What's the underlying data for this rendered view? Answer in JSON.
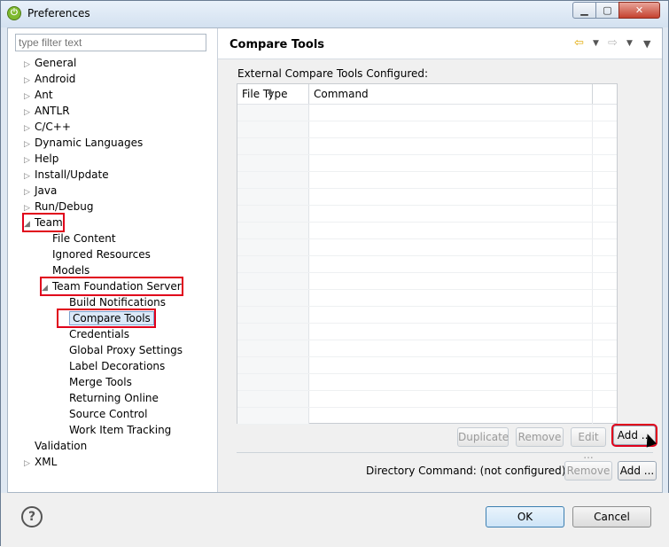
{
  "window": {
    "title": "Preferences",
    "app_icon": "eclipse-icon"
  },
  "filter": {
    "placeholder": "type filter text"
  },
  "tree": [
    {
      "label": "General",
      "arrow": "▷",
      "level": 0
    },
    {
      "label": "Android",
      "arrow": "▷",
      "level": 0
    },
    {
      "label": "Ant",
      "arrow": "▷",
      "level": 0
    },
    {
      "label": "ANTLR",
      "arrow": "▷",
      "level": 0
    },
    {
      "label": "C/C++",
      "arrow": "▷",
      "level": 0
    },
    {
      "label": "Dynamic Languages",
      "arrow": "▷",
      "level": 0
    },
    {
      "label": "Help",
      "arrow": "▷",
      "level": 0
    },
    {
      "label": "Install/Update",
      "arrow": "▷",
      "level": 0
    },
    {
      "label": "Java",
      "arrow": "▷",
      "level": 0
    },
    {
      "label": "Run/Debug",
      "arrow": "▷",
      "level": 0
    },
    {
      "label": "Team",
      "arrow": "◢",
      "level": 0
    },
    {
      "label": "File Content",
      "arrow": "",
      "level": 1
    },
    {
      "label": "Ignored Resources",
      "arrow": "",
      "level": 1
    },
    {
      "label": "Models",
      "arrow": "",
      "level": 1
    },
    {
      "label": "Team Foundation Server",
      "arrow": "◢",
      "level": 1
    },
    {
      "label": "Build Notifications",
      "arrow": "",
      "level": 2
    },
    {
      "label": "Compare Tools",
      "arrow": "",
      "level": 2
    },
    {
      "label": "Credentials",
      "arrow": "",
      "level": 2
    },
    {
      "label": "Global Proxy Settings",
      "arrow": "",
      "level": 2
    },
    {
      "label": "Label Decorations",
      "arrow": "",
      "level": 2
    },
    {
      "label": "Merge Tools",
      "arrow": "",
      "level": 2
    },
    {
      "label": "Returning Online",
      "arrow": "",
      "level": 2
    },
    {
      "label": "Source Control",
      "arrow": "",
      "level": 2
    },
    {
      "label": "Work Item Tracking",
      "arrow": "",
      "level": 2
    },
    {
      "label": "Validation",
      "arrow": "",
      "level": 0
    },
    {
      "label": "XML",
      "arrow": "▷",
      "level": 0
    }
  ],
  "page": {
    "title": "Compare Tools",
    "group_label": "External Compare Tools Configured:",
    "columns": [
      "File Type",
      "Command"
    ],
    "buttons": {
      "duplicate": "Duplicate",
      "remove": "Remove",
      "edit": "Edit ...",
      "add": "Add ..."
    },
    "directory_command": "Directory Command: (not configured)",
    "dir_remove": "Remove",
    "dir_add": "Add ..."
  },
  "footer": {
    "ok": "OK",
    "cancel": "Cancel",
    "help_icon": "help-icon"
  }
}
